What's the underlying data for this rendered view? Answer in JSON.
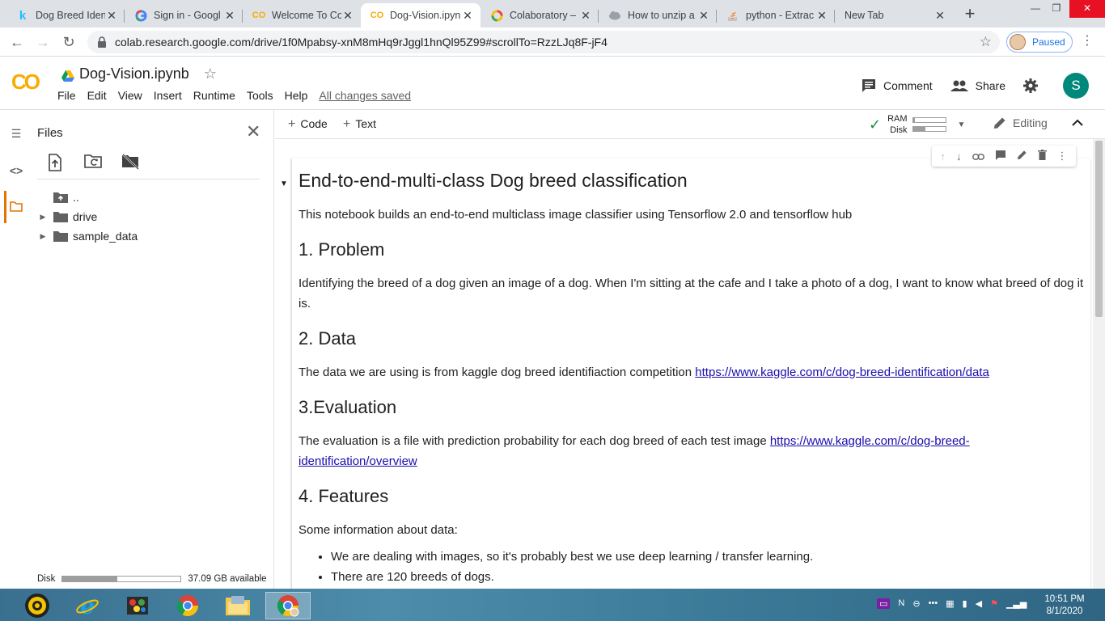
{
  "browser": {
    "tabs": [
      {
        "title": "Dog Breed Iden",
        "favicon": "kaggle-k",
        "active": false
      },
      {
        "title": "Sign in - Googl",
        "favicon": "google-g",
        "active": false
      },
      {
        "title": "Welcome To Co",
        "favicon": "colab-co",
        "active": false
      },
      {
        "title": "Dog-Vision.ipyn",
        "favicon": "colab-co",
        "active": true
      },
      {
        "title": "Colaboratory –",
        "favicon": "google-g",
        "active": false
      },
      {
        "title": "How to unzip a",
        "favicon": "cloud-icon",
        "active": false
      },
      {
        "title": "python - Extrac",
        "favicon": "stackoverflow-icon",
        "active": false
      },
      {
        "title": "New Tab",
        "favicon": "",
        "active": false
      }
    ],
    "url": "colab.research.google.com/drive/1f0Mpabsy-xnM8mHq9rJggl1hnQl95Z99#scrollTo=RzzLJq8F-jF4",
    "profile_status": "Paused"
  },
  "colab": {
    "logo": "CO",
    "notebook_title": "Dog-Vision.ipynb",
    "menu": [
      "File",
      "Edit",
      "View",
      "Insert",
      "Runtime",
      "Tools",
      "Help"
    ],
    "save_status": "All changes saved",
    "comment_label": "Comment",
    "share_label": "Share",
    "avatar_letter": "S"
  },
  "sidebar": {
    "title": "Files",
    "tree": [
      {
        "name": "..",
        "type": "up-folder"
      },
      {
        "name": "drive",
        "type": "folder"
      },
      {
        "name": "sample_data",
        "type": "folder"
      }
    ],
    "disk_label": "Disk",
    "disk_available": "37.09 GB available",
    "disk_used_fraction": 0.46
  },
  "nb_toolbar": {
    "add_code": "Code",
    "add_text": "Text",
    "ram_label": "RAM",
    "disk_label": "Disk",
    "ram_used_fraction": 0.06,
    "disk_used_fraction": 0.38,
    "mode_label": "Editing"
  },
  "notebook": {
    "heading": "End-to-end-multi-class Dog breed classification",
    "intro": "This notebook builds an end-to-end multiclass image classifier using Tensorflow 2.0 and tensorflow hub",
    "s1_title": "1. Problem",
    "s1_text": "Identifying the breed of a dog given an image of a dog. When I'm sitting at the cafe and I take a photo of a dog, I want to know what breed of dog it is.",
    "s2_title": "2. Data",
    "s2_text": "The data we are using is from kaggle dog breed identifiaction competition ",
    "s2_link": "https://www.kaggle.com/c/dog-breed-identification/data",
    "s3_title": "3.Evaluation",
    "s3_text": "The evaluation is a file with prediction probability for each dog breed of each test image ",
    "s3_link": "https://www.kaggle.com/c/dog-breed-identification/overview",
    "s4_title": "4. Features",
    "s4_text": "Some information about data:",
    "s4_bullets": [
      "We are dealing with images, so it's probably best we use deep learning / transfer learning.",
      "There are 120 breeds of dogs."
    ]
  },
  "taskbar": {
    "time": "10:51 PM",
    "date": "8/1/2020"
  },
  "colors": {
    "colab_orange": "#f9ab00",
    "link": "#1a0dab",
    "avatar_teal": "#00897b",
    "check_green": "#1e8e3e"
  }
}
